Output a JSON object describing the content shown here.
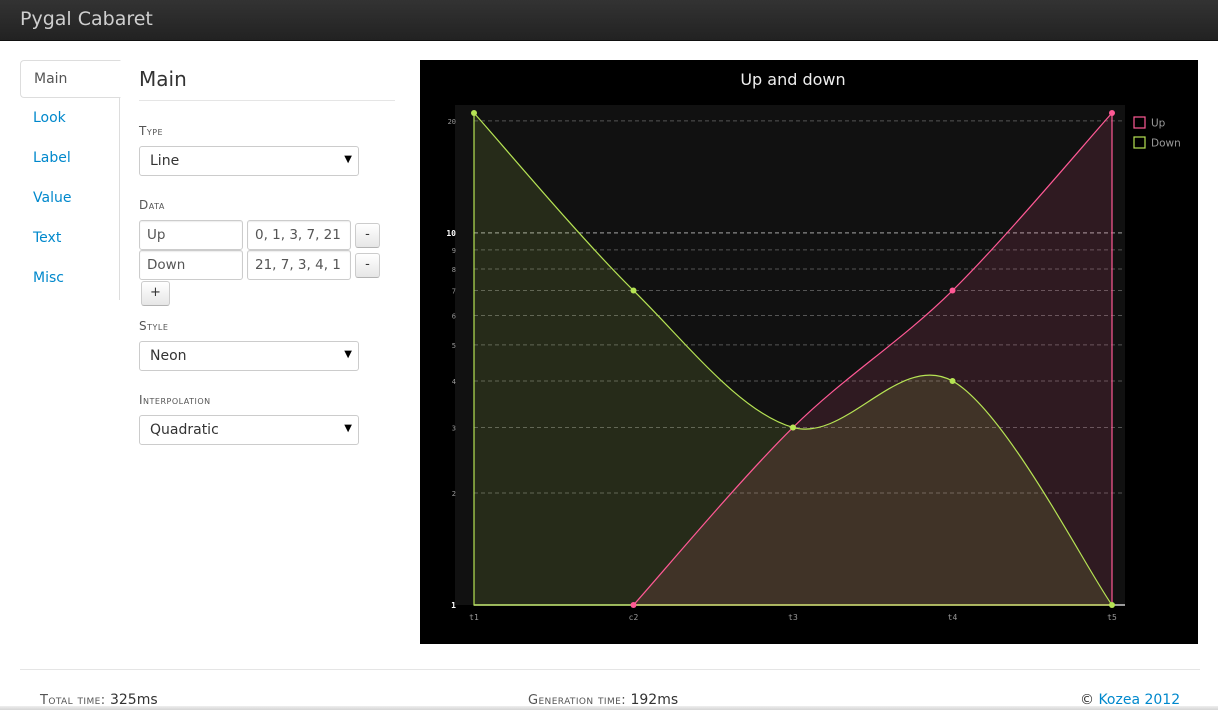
{
  "app": {
    "title": "Pygal Cabaret"
  },
  "tabs": [
    {
      "label": "Main",
      "active": true
    },
    {
      "label": "Look"
    },
    {
      "label": "Label"
    },
    {
      "label": "Value"
    },
    {
      "label": "Text"
    },
    {
      "label": "Misc"
    }
  ],
  "panel": {
    "title": "Main",
    "type_label": "Type",
    "type_value": "Line",
    "data_label": "Data",
    "series": [
      {
        "name": "Up",
        "values": "0, 1, 3, 7, 21",
        "remove_label": "-"
      },
      {
        "name": "Down",
        "values": "21, 7, 3, 4, 1",
        "remove_label": "-"
      }
    ],
    "add_label": "+",
    "style_label": "Style",
    "style_value": "Neon",
    "interpolation_label": "Interpolation",
    "interpolation_value": "Quadratic"
  },
  "chart_data": {
    "type": "line",
    "title": "Up and down",
    "categories": [
      "t1",
      "c2",
      "t3",
      "t4",
      "t5"
    ],
    "logarithmic": true,
    "interpolation": "quadratic",
    "fill": true,
    "y_major_ticks": [
      "1",
      "10"
    ],
    "y_ticks": [
      "20",
      "10",
      "9",
      "8",
      "7",
      "6",
      "5",
      "4",
      "3",
      "2",
      "1"
    ],
    "y_tick_values": [
      20,
      10,
      9,
      8,
      7,
      6,
      5,
      4,
      3,
      2,
      1
    ],
    "series": [
      {
        "name": "Up",
        "values": [
          null,
          1,
          3,
          7,
          21
        ],
        "color": "#ff5995"
      },
      {
        "name": "Down",
        "values": [
          21,
          7,
          3,
          4,
          1
        ],
        "color": "#b6e354"
      }
    ],
    "legend_position": "right",
    "grid": true
  },
  "footer": {
    "total_label": "Total time:",
    "total_value": "325ms",
    "generation_label": "Generation time:",
    "generation_value": "192ms",
    "copyright_symbol": "©",
    "copyright_link": "Kozea 2012"
  },
  "colors": {
    "link": "#0088cc",
    "navbar": "#222222",
    "chart_background": "#000000",
    "plot_background": "#111111"
  }
}
